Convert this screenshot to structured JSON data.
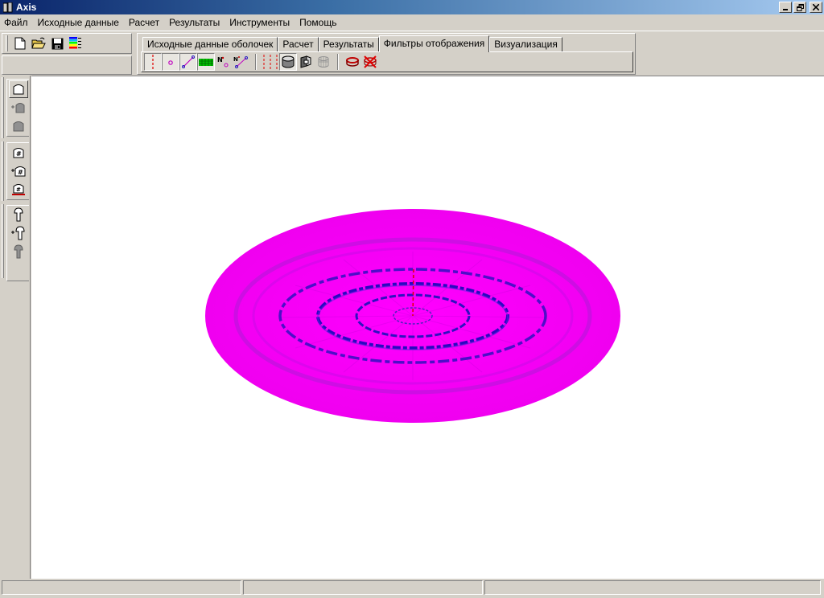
{
  "window": {
    "title": "Axis"
  },
  "menu": [
    {
      "label": "Файл"
    },
    {
      "label": "Исходные данные"
    },
    {
      "label": "Расчет"
    },
    {
      "label": "Результаты"
    },
    {
      "label": "Инструменты"
    },
    {
      "label": "Помощь"
    }
  ],
  "tabs": [
    {
      "label": "Исходные данные оболочек",
      "active": false
    },
    {
      "label": "Расчет",
      "active": false
    },
    {
      "label": "Результаты",
      "active": false
    },
    {
      "label": "Фильтры отображения",
      "active": true
    },
    {
      "label": "Визуализация",
      "active": false
    }
  ],
  "colors": {
    "disk_fill": "#ff00ff",
    "ring_dark": "#2a10c8",
    "axis_line": "#e00000",
    "title_start": "#0a246a",
    "title_end": "#a6caf0"
  },
  "icons": {
    "std_toolbar": [
      "new-file-icon",
      "open-folder-icon",
      "save-icon",
      "color-palette-icon"
    ],
    "filter_toolbar": [
      "axis-line-icon",
      "node-point-icon",
      "element-line-icon",
      "grid-mesh-icon",
      "node-number-icon",
      "element-number-icon",
      "vertical-lines-icon",
      "shell-cylinder-icon",
      "shell-section-icon",
      "shell-wireframe-icon",
      "ring-icon",
      "hide-all-icon"
    ],
    "left_toolbar": [
      "shell-icon",
      "add-shell-icon",
      "shell-disabled-icon",
      "grid-house-icon",
      "add-grid-house-icon",
      "grid-house-ground-icon",
      "support-icon",
      "add-support-icon",
      "support-disabled-icon"
    ]
  },
  "status": [
    "",
    "",
    ""
  ]
}
